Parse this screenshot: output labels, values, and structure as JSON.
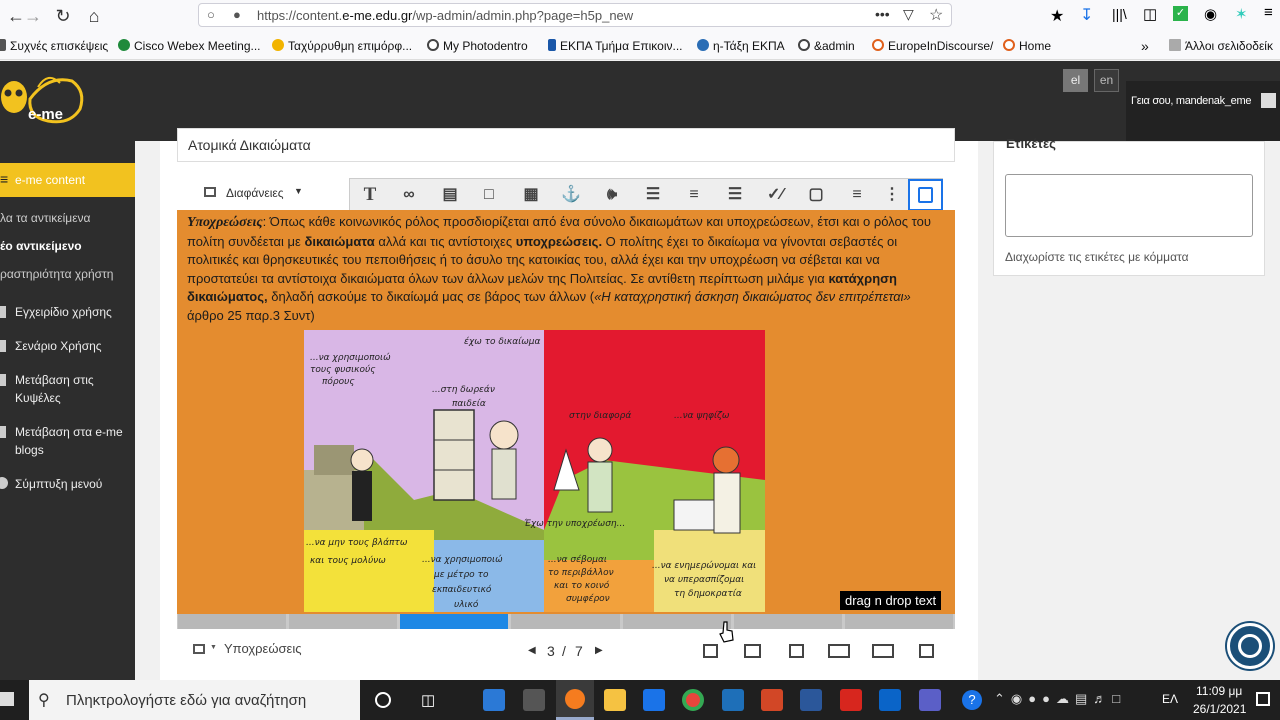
{
  "browser": {
    "url_prefix": "https://content.",
    "url_domain": "e-me.edu.gr",
    "url_path": "/wp-admin/admin.php?page=h5p_new"
  },
  "bookmarks": [
    {
      "label": "Συχνές επισκέψεις",
      "color": "#555"
    },
    {
      "label": "Cisco Webex Meeting...",
      "color": "#1f8a3b"
    },
    {
      "label": "Ταχύρρυθμη επιμόρφ...",
      "color": "#f2b400"
    },
    {
      "label": "My Photodentro",
      "color": "#444"
    },
    {
      "label": "ΕΚΠΑ Τμήμα Επικοιν...",
      "color": "#1a57a8"
    },
    {
      "label": "η-Τάξη ΕΚΠΑ",
      "color": "#2a6db5"
    },
    {
      "label": "&admin",
      "color": "#444"
    },
    {
      "label": "EuropeInDiscourse/",
      "color": "#e0601c"
    },
    {
      "label": "Home",
      "color": "#e0601c"
    }
  ],
  "bookmarks_other": "Άλλοι σελιδοδείκ",
  "header": {
    "lang_el": "el",
    "lang_en": "en",
    "greeting": "Γεια σου, mandenak_eme"
  },
  "sidebar": {
    "active": "e-me content",
    "subitems": [
      "λα τα αντικείμενα",
      "έο αντικείμενο",
      "ραστηριότητα χρήστη"
    ],
    "items": [
      {
        "line1": "Εγχειρίδιο χρήσης",
        "line2": ""
      },
      {
        "line1": "Σενάριο Χρήσης",
        "line2": ""
      },
      {
        "line1": "Μετάβαση στις",
        "line2": "Κυψέλες"
      },
      {
        "line1": "Μετάβαση στα e-me",
        "line2": "blogs"
      },
      {
        "line1": "Σύμπτυξη μενού",
        "line2": ""
      }
    ]
  },
  "editor": {
    "title": "Ατομικά Δικαιώματα",
    "slides_label": "Διαφάνειες",
    "paragraph_html_parts": {
      "lead": "Υποχρεώσεις",
      "t1": ": Όπως κάθε κοινωνικός ρόλος προσδιορίζεται από ένα σύνολο δικαιωμάτων και υποχρεώσεων, έτσι και ο ρόλος του πολίτη συνδέεται με ",
      "b1": "δικαιώματα",
      "t2": " αλλά και τις αντίστοιχες ",
      "b2": "υποχρεώσεις.",
      "t3": " Ο πολίτης έχει το δικαίωμα να γίνονται σεβαστές οι πολιτικές και θρησκευτικές του πεποιθήσεις ή το άσυλο της κατοικίας του, αλλά έχει και την υποχρέωση να σέβεται και να προστατεύει τα αντίστοιχα δικαιώματα όλων των άλλων μελών της Πολιτείας. Σε αντίθετη περίπτωση μιλάμε για ",
      "b3": "κατάχρηση δικαιώματος,",
      "t4": " δηλαδή ασκούμε το δικαίωμά μας σε βάρος των άλλων (",
      "i1": "«Η καταχρηστική άσκηση δικαιώματος δεν επιτρέπεται»",
      "t5": " άρθρο 25 παρ.3 Συντ)"
    },
    "image_labels": {
      "top": "έχω το δικαίωμα",
      "l1a": "...να χρησιμοποιώ",
      "l1b": "τους φυσικούς",
      "l1c": "πόρους",
      "l2a": "...στη δωρεάν",
      "l2b": "παιδεία",
      "l3": "στην διαφορά",
      "l4": "...να ψηφίζω",
      "mid": "Έχω την υποχρέωση...",
      "b1a": "...να μην τους βλάπτω",
      "b1b": "και τους μολύνω",
      "b2a": "...να χρησιμοποιώ",
      "b2b": "με μέτρο το",
      "b2c": "εκπαιδευτικό",
      "b2d": "υλικό",
      "b3a": "...να σέβομαι",
      "b3b": "το περιβάλλον",
      "b3c": "και το κοινό",
      "b3d": "συμφέρον",
      "b4a": "...να ενημερώνομαι και",
      "b4b": "να υπερασπίζομαι",
      "b4c": "τη δημοκρατία"
    },
    "tooltip": "drag n drop text",
    "slide_name": "Υποχρεώσεις",
    "page_current": "3",
    "page_total": "7",
    "progress_current_index": 2,
    "progress_segments": 7
  },
  "tags": {
    "title": "Ετικέτες",
    "hint": "Διαχωρίστε τις ετικέτες με κόμματα"
  },
  "taskbar": {
    "search_placeholder": "Πληκτρολογήστε εδώ για αναζήτηση",
    "lang": "ΕΛ",
    "time": "11:09 μμ",
    "date": "26/1/2021"
  }
}
